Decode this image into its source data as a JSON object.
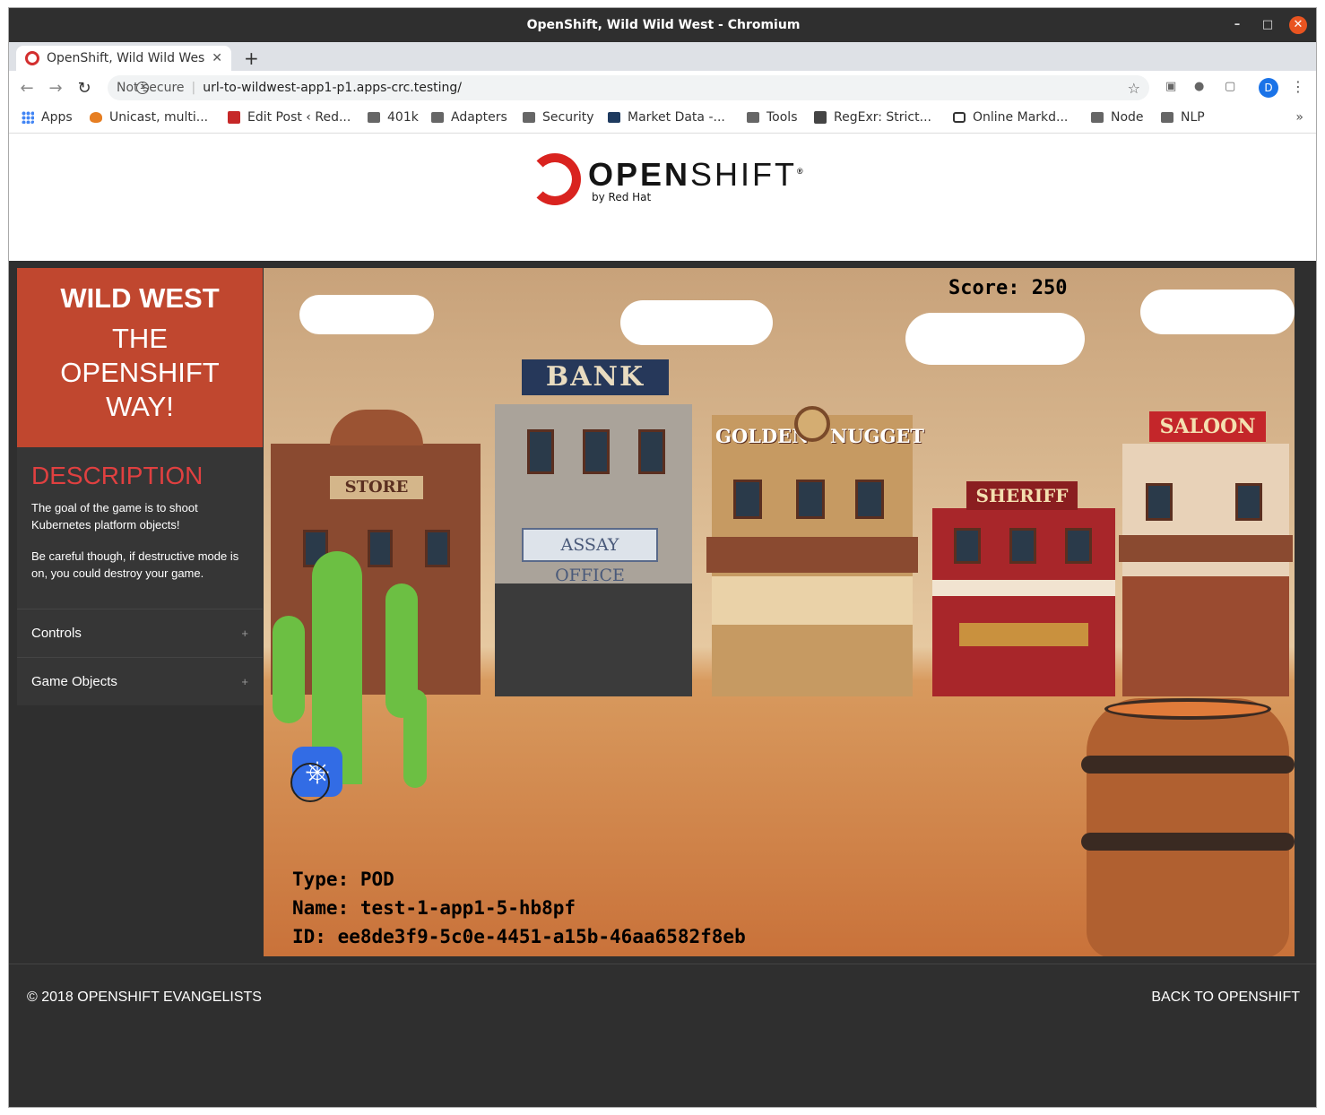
{
  "window": {
    "title": "OpenShift, Wild Wild West - Chromium",
    "min": "–",
    "max": "□",
    "close": "✕"
  },
  "tab": {
    "label": "OpenShift, Wild Wild Wes",
    "close": "✕",
    "new": "+"
  },
  "address": {
    "security": "Not secure",
    "url": "url-to-wildwest-app1-p1.apps-crc.testing/"
  },
  "profile": {
    "initial": "D"
  },
  "bookmarks": [
    {
      "label": "Apps",
      "icon": "apps-grid-icon"
    },
    {
      "label": "Unicast, multi...",
      "icon": "shield-icon"
    },
    {
      "label": "Edit Post ‹ Red...",
      "icon": "post-icon"
    },
    {
      "label": "401k",
      "icon": "folder-icon"
    },
    {
      "label": "Adapters",
      "icon": "folder-icon"
    },
    {
      "label": "Security",
      "icon": "folder-icon"
    },
    {
      "label": "Market Data -...",
      "icon": "ms-icon"
    },
    {
      "label": "Tools",
      "icon": "folder-icon"
    },
    {
      "label": "RegExr: Strict...",
      "icon": "regexr-icon"
    },
    {
      "label": "Online Markd...",
      "icon": "markdown-icon"
    },
    {
      "label": "Node",
      "icon": "folder-icon"
    },
    {
      "label": "NLP",
      "icon": "folder-icon"
    }
  ],
  "bookmarks_more": "»",
  "logo": {
    "word_bold": "OPEN",
    "word_light": "SHIFT",
    "reg": "®",
    "by": "by Red Hat"
  },
  "sidebar": {
    "title": "WILD WEST",
    "subtitle_lines": [
      "THE",
      "OPENSHIFT",
      "WAY!"
    ],
    "desc_heading": "DESCRIPTION",
    "desc_p1": "The goal of the game is to shoot Kubernetes platform objects!",
    "desc_p2": "Be careful though, if destructive mode is on, you could destroy your game.",
    "sections": [
      {
        "label": "Controls",
        "toggle": "+"
      },
      {
        "label": "Game Objects",
        "toggle": "+"
      }
    ]
  },
  "game": {
    "score": "Score: 250",
    "signs": {
      "store": "STORE",
      "bank": "BANK",
      "assay": "ASSAY OFFICE",
      "golden": "GOLDEN",
      "nugget": "NUGGET",
      "sheriff": "SHERIFF",
      "saloon": "SALOON"
    },
    "object": {
      "type": "Type: POD",
      "name": "Name: test-1-app1-5-hb8pf",
      "id": "ID: ee8de3f9-5c0e-4451-a15b-46aa6582f8eb"
    }
  },
  "footer": {
    "copyright": "© 2018 OPENSHIFT EVANGELISTS",
    "back": "BACK TO OPENSHIFT"
  }
}
